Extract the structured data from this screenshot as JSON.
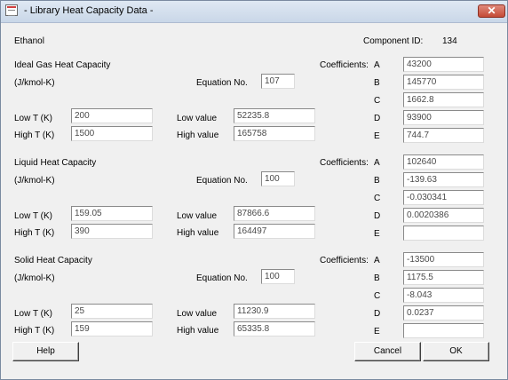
{
  "window": {
    "title": "- Library Heat Capacity Data -",
    "close_glyph": "✕"
  },
  "component": {
    "name": "Ethanol",
    "id_label": "Component ID:",
    "id_value": "134"
  },
  "labels": {
    "units": "(J/kmol-K)",
    "equation_no": "Equation No.",
    "low_t": "Low T (K)",
    "high_t": "High T (K)",
    "low_value": "Low value",
    "high_value": "High value",
    "coefficients": "Coefficients:",
    "coef_letters": [
      "A",
      "B",
      "C",
      "D",
      "E"
    ]
  },
  "sections": [
    {
      "title": "Ideal Gas Heat Capacity",
      "equation": "107",
      "low_t": "200",
      "high_t": "1500",
      "low_value": "52235.8",
      "high_value": "165758",
      "coefficients": [
        "43200",
        "145770",
        "1662.8",
        "93900",
        "744.7"
      ]
    },
    {
      "title": "Liquid Heat Capacity",
      "equation": "100",
      "low_t": "159.05",
      "high_t": "390",
      "low_value": "87866.6",
      "high_value": "164497",
      "coefficients": [
        "102640",
        "-139.63",
        "-0.030341",
        "0.0020386",
        ""
      ]
    },
    {
      "title": "Solid Heat Capacity",
      "equation": "100",
      "low_t": "25",
      "high_t": "159",
      "low_value": "11230.9",
      "high_value": "65335.8",
      "coefficients": [
        "-13500",
        "1175.5",
        "-8.043",
        "0.0237",
        ""
      ]
    }
  ],
  "buttons": {
    "help": "Help",
    "cancel": "Cancel",
    "ok": "OK"
  }
}
